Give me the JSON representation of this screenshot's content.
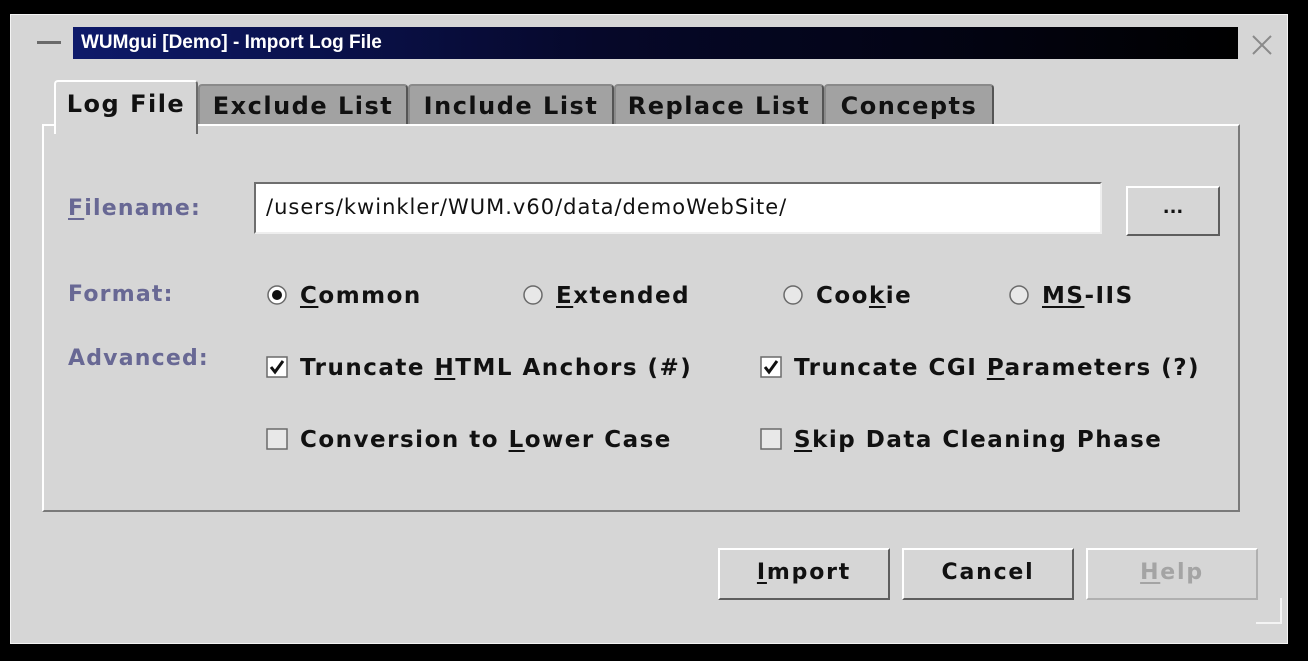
{
  "window": {
    "title": "WUMgui [Demo] - Import Log File",
    "title_gradient": [
      "#0e1a6a",
      "#000000"
    ]
  },
  "tabs": [
    {
      "label": "Log File",
      "active": true
    },
    {
      "label": "Exclude List",
      "active": false
    },
    {
      "label": "Include List",
      "active": false
    },
    {
      "label": "Replace List",
      "active": false
    },
    {
      "label": "Concepts",
      "active": false
    }
  ],
  "log_file": {
    "filename_label": {
      "pre": "",
      "mnemonic": "F",
      "post": "ilename:"
    },
    "filename_value": "/users/kwinkler/WUM.v60/data/demoWebSite/",
    "browse_label": "...",
    "format_label": "Format:",
    "formats": [
      {
        "pre": "",
        "mnemonic": "C",
        "post": "ommon",
        "selected": true
      },
      {
        "pre": "",
        "mnemonic": "E",
        "post": "xtended",
        "selected": false
      },
      {
        "pre": "Coo",
        "mnemonic": "k",
        "post": "ie",
        "selected": false
      },
      {
        "pre": "",
        "mnemonic": "MS",
        "post": "-IIS",
        "selected": false
      }
    ],
    "advanced_label": "Advanced:",
    "options": [
      {
        "pre": "Truncate ",
        "mnemonic": "H",
        "post": "TML Anchors (#)",
        "checked": true
      },
      {
        "pre": "Truncate CGI ",
        "mnemonic": "P",
        "post": "arameters (?)",
        "checked": true
      },
      {
        "pre": "Conversion to ",
        "mnemonic": "L",
        "post": "ower Case",
        "checked": false
      },
      {
        "pre": "",
        "mnemonic": "S",
        "post": "kip Data Cleaning Phase",
        "checked": false
      }
    ]
  },
  "buttons": {
    "import": {
      "pre": "",
      "mnemonic": "I",
      "post": "mport"
    },
    "cancel": {
      "pre": "Cancel",
      "mnemonic": "",
      "post": ""
    },
    "help": {
      "pre": "",
      "mnemonic": "H",
      "post": "elp",
      "disabled": true
    }
  },
  "colors": {
    "label": "#686894",
    "window_bg": "#d6d6d6",
    "inactive_tab": "#a2a2a2"
  }
}
